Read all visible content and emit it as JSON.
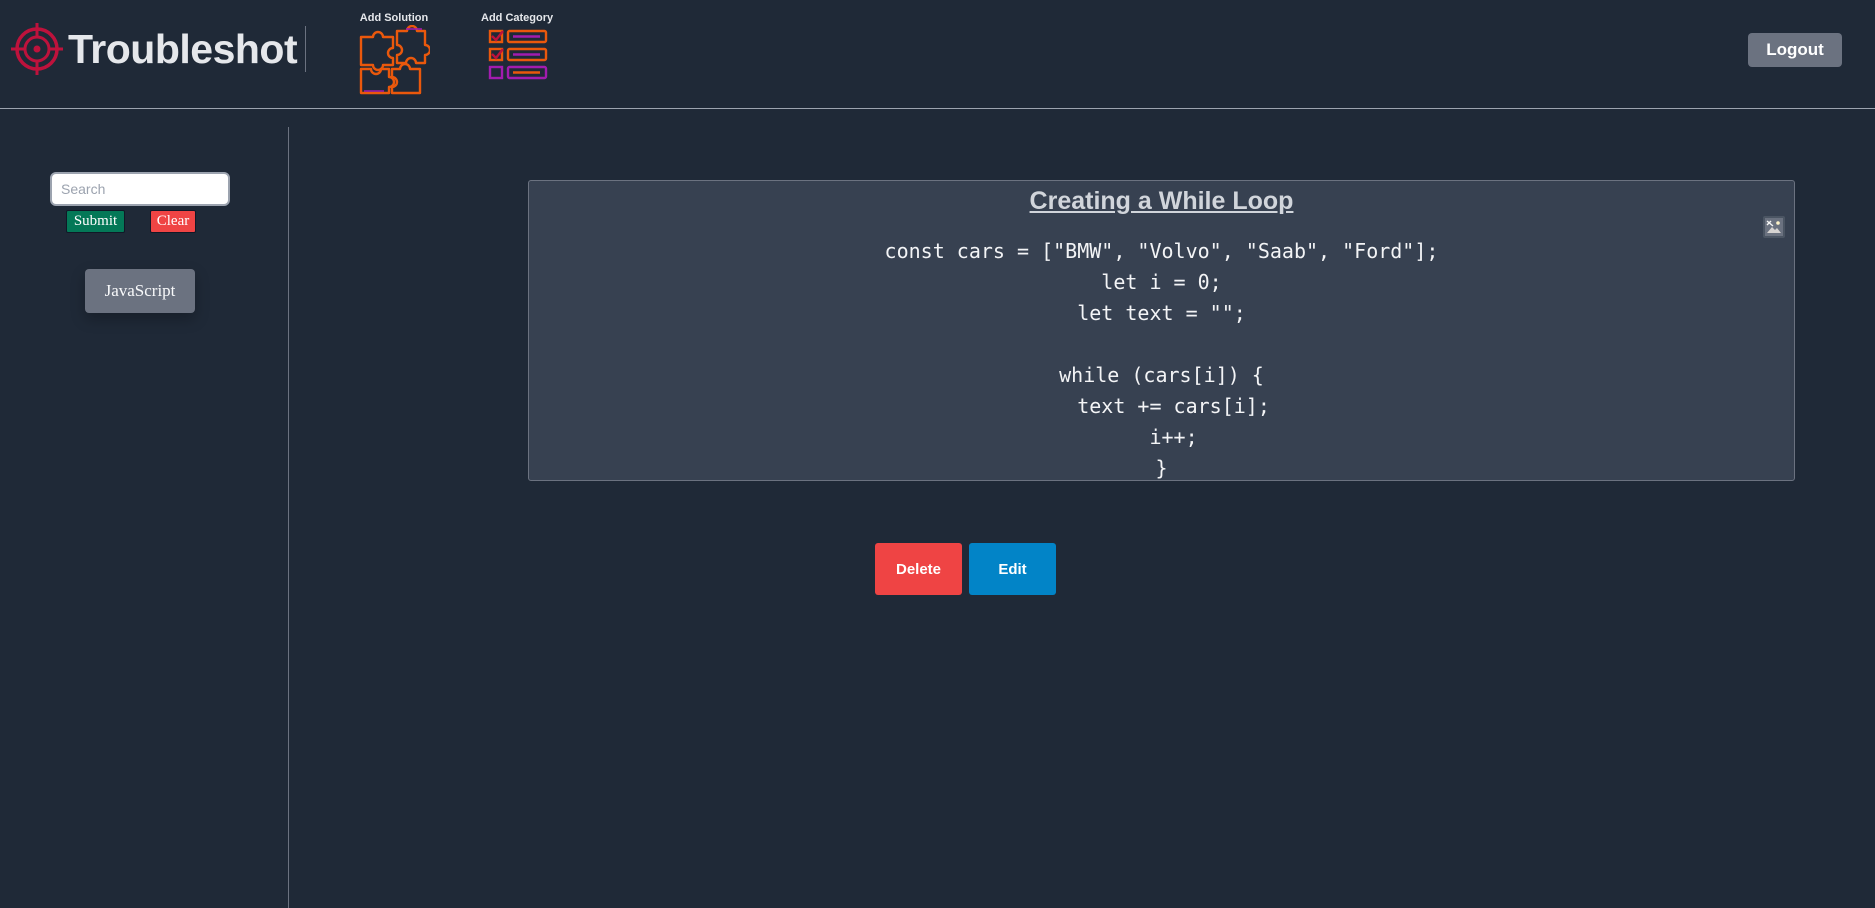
{
  "header": {
    "app_name": "Troubleshot",
    "logo_icon": "target-icon",
    "nav": [
      {
        "label": "Add Solution",
        "icon": "puzzle-icon"
      },
      {
        "label": "Add Category",
        "icon": "checklist-icon"
      }
    ],
    "logout_label": "Logout"
  },
  "sidebar": {
    "search_placeholder": "Search",
    "search_value": "",
    "submit_label": "Submit",
    "clear_label": "Clear",
    "categories": [
      {
        "label": "JavaScript"
      }
    ]
  },
  "solution": {
    "title": "Creating a While Loop",
    "code": "const cars = [\"BMW\", \"Volvo\", \"Saab\", \"Ford\"];\nlet i = 0;\nlet text = \"\";\n\nwhile (cars[i]) {\n  text += cars[i];\n  i++;\n}",
    "attachment_icon": "broken-image-icon"
  },
  "actions": {
    "delete_label": "Delete",
    "edit_label": "Edit"
  },
  "colors": {
    "background": "#1f2937",
    "card": "#374151",
    "accent_red": "#ef4444",
    "accent_blue": "#0284c7",
    "accent_green": "#047857",
    "logo_red": "#be123c",
    "icon_orange": "#ea580c",
    "icon_purple": "#a21caf"
  }
}
